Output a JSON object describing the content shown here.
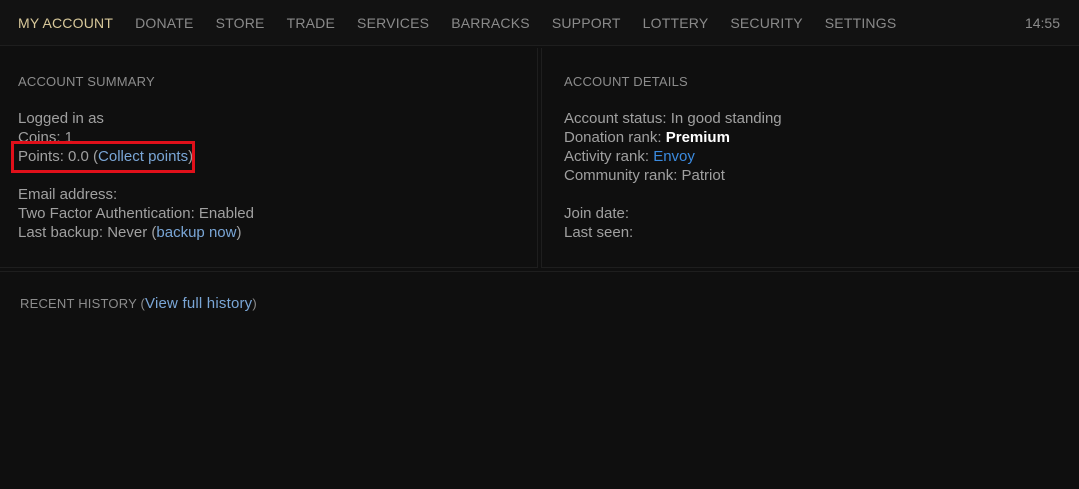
{
  "nav": {
    "items": [
      {
        "label": "MY ACCOUNT",
        "active": true
      },
      {
        "label": "DONATE"
      },
      {
        "label": "STORE"
      },
      {
        "label": "TRADE"
      },
      {
        "label": "SERVICES"
      },
      {
        "label": "BARRACKS"
      },
      {
        "label": "SUPPORT"
      },
      {
        "label": "LOTTERY"
      },
      {
        "label": "SECURITY"
      },
      {
        "label": "SETTINGS"
      }
    ],
    "clock": "14:55"
  },
  "summary": {
    "title": "ACCOUNT SUMMARY",
    "logged_in": "Logged in as",
    "coins": "Coins: 1",
    "points_prefix": "Points: 0.0 (",
    "collect_link": "Collect points",
    "points_suffix": ")",
    "email": "Email address:",
    "two_factor": "Two Factor Authentication: Enabled",
    "backup_prefix": "Last backup: Never (",
    "backup_link": "backup now",
    "backup_suffix": ")"
  },
  "details": {
    "title": "ACCOUNT DETAILS",
    "status": "Account status: In good standing",
    "donation_label": "Donation rank: ",
    "donation_value": "Premium",
    "activity_label": "Activity rank: ",
    "activity_value": "Envoy",
    "community": "Community rank: Patriot",
    "join_date": "Join date:",
    "last_seen": "Last seen:"
  },
  "history": {
    "title_prefix": "RECENT HISTORY (",
    "link": "View full history",
    "title_suffix": ")"
  },
  "colors": {
    "accent": "#d8c89a",
    "link": "#7aa6d6",
    "envoy": "#3b8be0",
    "highlight": "#e0101a"
  }
}
